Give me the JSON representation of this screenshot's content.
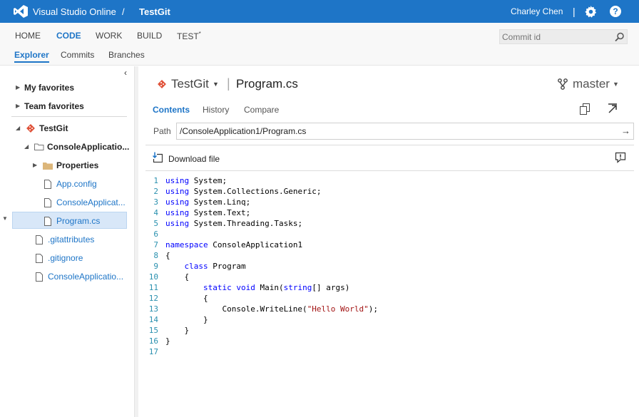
{
  "topbar": {
    "product": "Visual Studio Online",
    "separator": "/",
    "project": "TestGit",
    "user": "Charley Chen",
    "divider": "|",
    "help": "?"
  },
  "hub": {
    "tabs": [
      "HOME",
      "CODE",
      "WORK",
      "BUILD",
      "TEST"
    ],
    "active_tab": "CODE",
    "test_marker": "*",
    "commit_placeholder": "Commit id",
    "subtabs": [
      "Explorer",
      "Commits",
      "Branches"
    ],
    "active_subtab": "Explorer"
  },
  "sidebar": {
    "collapse_glyph": "‹",
    "favorites": [
      "My favorites",
      "Team favorites"
    ],
    "tree": [
      {
        "label": "TestGit",
        "type": "repo",
        "expanded": true
      },
      {
        "label": "ConsoleApplicatio...",
        "type": "folder",
        "expanded": true
      },
      {
        "label": "Properties",
        "type": "folder",
        "expanded": false
      },
      {
        "label": "App.config",
        "type": "file"
      },
      {
        "label": "ConsoleApplicat...",
        "type": "file"
      },
      {
        "label": "Program.cs",
        "type": "file",
        "selected": true
      },
      {
        "label": ".gitattributes",
        "type": "file"
      },
      {
        "label": ".gitignore",
        "type": "file"
      },
      {
        "label": "ConsoleApplicatio...",
        "type": "file"
      }
    ]
  },
  "main": {
    "repo": "TestGit",
    "bar": "|",
    "file": "Program.cs",
    "branch": "master",
    "tabs": [
      "Contents",
      "History",
      "Compare"
    ],
    "active_tab": "Contents",
    "path_label": "Path",
    "path_value": "/ConsoleApplication1/Program.cs",
    "path_go": "→",
    "download_label": "Download file"
  },
  "code": {
    "lines": [
      {
        "n": "1",
        "tokens": [
          [
            "kw",
            "using"
          ],
          [
            "t",
            " System;"
          ]
        ]
      },
      {
        "n": "2",
        "tokens": [
          [
            "kw",
            "using"
          ],
          [
            "t",
            " System.Collections.Generic;"
          ]
        ]
      },
      {
        "n": "3",
        "tokens": [
          [
            "kw",
            "using"
          ],
          [
            "t",
            " System.Linq;"
          ]
        ]
      },
      {
        "n": "4",
        "tokens": [
          [
            "kw",
            "using"
          ],
          [
            "t",
            " System.Text;"
          ]
        ]
      },
      {
        "n": "5",
        "tokens": [
          [
            "kw",
            "using"
          ],
          [
            "t",
            " System.Threading.Tasks;"
          ]
        ]
      },
      {
        "n": "6",
        "tokens": []
      },
      {
        "n": "7",
        "tokens": [
          [
            "kw",
            "namespace"
          ],
          [
            "t",
            " ConsoleApplication1"
          ]
        ]
      },
      {
        "n": "8",
        "tokens": [
          [
            "t",
            "{"
          ]
        ]
      },
      {
        "n": "9",
        "tokens": [
          [
            "t",
            "    "
          ],
          [
            "kw",
            "class"
          ],
          [
            "t",
            " Program"
          ]
        ]
      },
      {
        "n": "10",
        "tokens": [
          [
            "t",
            "    {"
          ]
        ]
      },
      {
        "n": "11",
        "tokens": [
          [
            "t",
            "        "
          ],
          [
            "kw",
            "static"
          ],
          [
            "t",
            " "
          ],
          [
            "kw",
            "void"
          ],
          [
            "t",
            " Main("
          ],
          [
            "kw",
            "string"
          ],
          [
            "t",
            "[] args)"
          ]
        ]
      },
      {
        "n": "12",
        "tokens": [
          [
            "t",
            "        {"
          ]
        ]
      },
      {
        "n": "13",
        "tokens": [
          [
            "t",
            "            Console.WriteLine("
          ],
          [
            "str",
            "\"Hello World\""
          ],
          [
            "t",
            ");"
          ]
        ]
      },
      {
        "n": "14",
        "tokens": [
          [
            "t",
            "        }"
          ]
        ]
      },
      {
        "n": "15",
        "tokens": [
          [
            "t",
            "    }"
          ]
        ]
      },
      {
        "n": "16",
        "tokens": [
          [
            "t",
            "}"
          ]
        ]
      },
      {
        "n": "17",
        "tokens": []
      }
    ]
  },
  "colors": {
    "accent": "#1e75c7",
    "keyword": "#0000ff",
    "string": "#a31515",
    "line_number": "#2b91af",
    "git_icon": "#e0533a",
    "folder": "#dcb67a"
  }
}
